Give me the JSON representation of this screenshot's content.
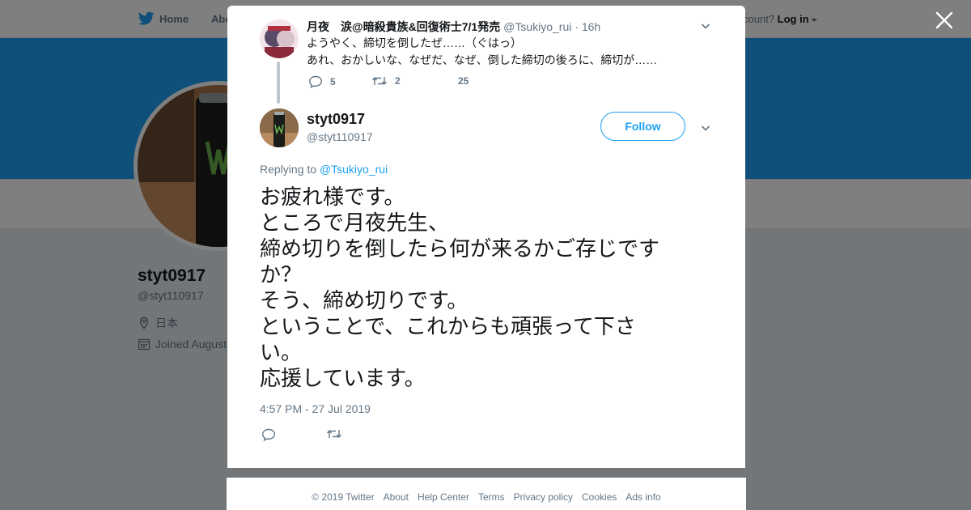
{
  "topnav": {
    "home_label": "Home",
    "about_label": "Abo",
    "account_prompt": "count?",
    "login_label": "Log in"
  },
  "profile": {
    "name": "styt0917",
    "handle": "@styt110917",
    "location": "日本",
    "joined": "Joined August"
  },
  "parent_tweet": {
    "author_name": "月夜　涙@暗殺貴族&回復術士7/1発売",
    "author_handle": "@Tsukiyo_rui",
    "age": "· 16h",
    "lines": [
      "ようやく、締切を倒したぜ……（ぐはっ）",
      "あれ、おかしいな、なぜだ、なぜ、倒した締切の後ろに、締切が……"
    ],
    "reply_count": "5",
    "retweet_count": "2",
    "like_count": "25"
  },
  "main_tweet": {
    "author_name": "styt0917",
    "author_handle": "@styt110917",
    "follow_label": "Follow",
    "replying_prefix": "Replying to",
    "replying_to": "@Tsukiyo_rui",
    "lines": [
      "お疲れ様です。",
      "ところで月夜先生、",
      "締め切りを倒したら何が来るかご存じです",
      "か？",
      "そう、締め切りです。",
      "ということで、これからも頑張って下さ",
      "い。",
      "応援しています。"
    ],
    "timestamp": "4:57 PM - 27 Jul 2019"
  },
  "footer": {
    "links": [
      "© 2019 Twitter",
      "About",
      "Help Center",
      "Terms",
      "Privacy policy",
      "Cookies",
      "Ads info"
    ]
  },
  "colors": {
    "brand": "#1da1f2",
    "muted": "#657786",
    "text": "#14171a"
  },
  "icons": [
    "twitter-bird-icon",
    "close-icon",
    "chevron-down-icon",
    "reply-icon",
    "retweet-icon",
    "like-icon",
    "location-icon",
    "calendar-icon"
  ]
}
